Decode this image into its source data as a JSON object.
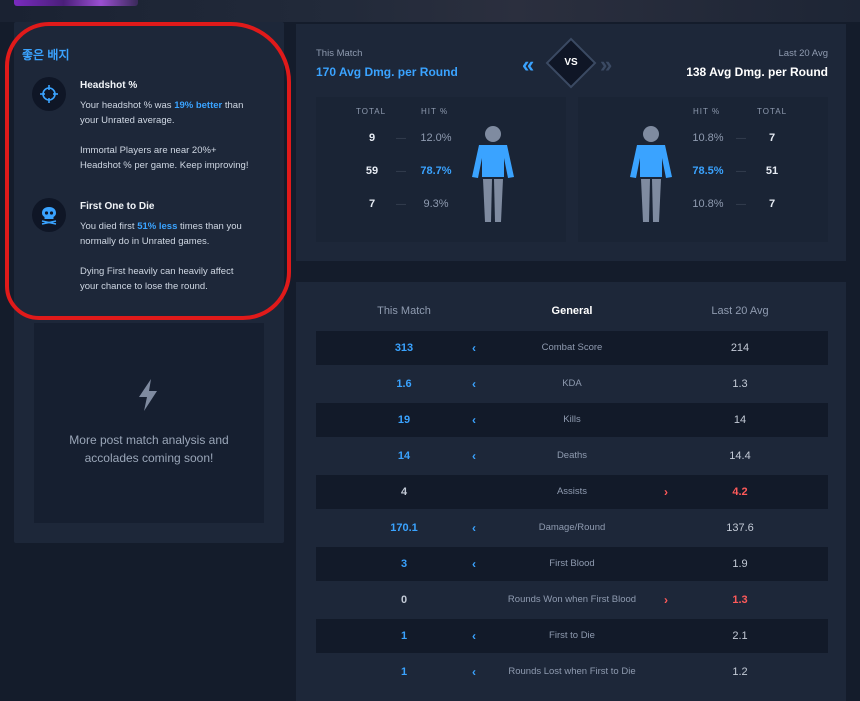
{
  "colors": {
    "accent_blue": "#3aa3ff",
    "accent_red": "#ff5a5a",
    "muted": "#8f9bb0",
    "panel": "#1d2739"
  },
  "badges": {
    "title": "좋은 배지",
    "items": [
      {
        "icon": "crosshair-icon",
        "title": "Headshot %",
        "line1_pre": "Your headshot % was ",
        "line1_hl": "19% better",
        "line1_post": " than",
        "line2": "your Unrated average.",
        "line3": "Immortal Players are near 20%+",
        "line4": "Headshot % per game. Keep improving!"
      },
      {
        "icon": "skull-icon",
        "title": "First One to Die",
        "line1_pre": "You died first ",
        "line1_hl": "51% less",
        "line1_post": " times than you",
        "line2": "normally do in Unrated games.",
        "line3": "Dying First heavily can heavily affect",
        "line4": "your chance to lose the round."
      }
    ]
  },
  "coming_soon": {
    "icon": "lightning-icon",
    "line1": "More post match analysis and",
    "line2": "accolades coming soon!"
  },
  "comparison": {
    "this_match_label": "This Match",
    "this_match_value": "170 Avg Dmg. per Round",
    "last20_label": "Last 20 Avg",
    "last20_value": "138 Avg Dmg. per Round",
    "vs": "VS",
    "chev_left": "«",
    "chev_right": "»",
    "col_total": "TOTAL",
    "col_hit": "HIT %",
    "dash": "—",
    "left_rows": [
      {
        "total": "9",
        "hit": "12.0%"
      },
      {
        "total": "59",
        "hit": "78.7%"
      },
      {
        "total": "7",
        "hit": "9.3%"
      }
    ],
    "right_rows": [
      {
        "total": "7",
        "hit": "10.8%"
      },
      {
        "total": "51",
        "hit": "78.5%"
      },
      {
        "total": "7",
        "hit": "10.8%"
      }
    ]
  },
  "general": {
    "head_left": "This Match",
    "head_mid": "General",
    "head_right": "Last 20 Avg",
    "rows": [
      {
        "stat": "Combat Score",
        "this": "313",
        "last": "214",
        "arrow": "‹",
        "winner": "this"
      },
      {
        "stat": "KDA",
        "this": "1.6",
        "last": "1.3",
        "arrow": "‹",
        "winner": "this"
      },
      {
        "stat": "Kills",
        "this": "19",
        "last": "14",
        "arrow": "‹",
        "winner": "this"
      },
      {
        "stat": "Deaths",
        "this": "14",
        "last": "14.4",
        "arrow": "‹",
        "winner": "this"
      },
      {
        "stat": "Assists",
        "this": "4",
        "last": "4.2",
        "arrow": "›",
        "winner": "last"
      },
      {
        "stat": "Damage/Round",
        "this": "170.1",
        "last": "137.6",
        "arrow": "‹",
        "winner": "this"
      },
      {
        "stat": "First Blood",
        "this": "3",
        "last": "1.9",
        "arrow": "‹",
        "winner": "this"
      },
      {
        "stat": "Rounds Won when First Blood",
        "this": "0",
        "last": "1.3",
        "arrow": "›",
        "winner": "last"
      },
      {
        "stat": "First to Die",
        "this": "1",
        "last": "2.1",
        "arrow": "‹",
        "winner": "this"
      },
      {
        "stat": "Rounds Lost when First to Die",
        "this": "1",
        "last": "1.2",
        "arrow": "‹",
        "winner": "this"
      }
    ]
  }
}
